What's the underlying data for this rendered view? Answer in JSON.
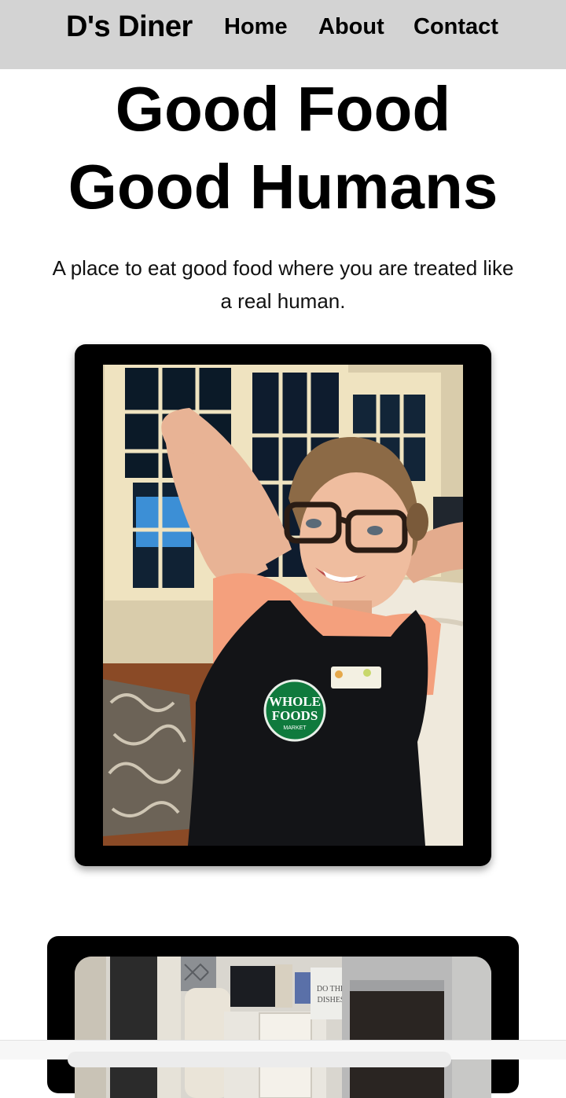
{
  "nav": {
    "brand": "D's Diner",
    "links": [
      "Home",
      "About",
      "Contact"
    ]
  },
  "hero": {
    "line1": "Good Food",
    "line2": "Good Humans",
    "tagline": "A place to eat good food where you are treated like a real human."
  },
  "photos": [
    {
      "badge_line1": "WHOLE",
      "badge_line2": "FOODS",
      "badge_line3": "MARKET"
    },
    {
      "towel_line1": "DO THE",
      "towel_line2": "DISHES"
    }
  ],
  "colors": {
    "navbar_bg": "#d3d3d3",
    "frame": "#000000",
    "badge_green": "#0f7a3d"
  }
}
